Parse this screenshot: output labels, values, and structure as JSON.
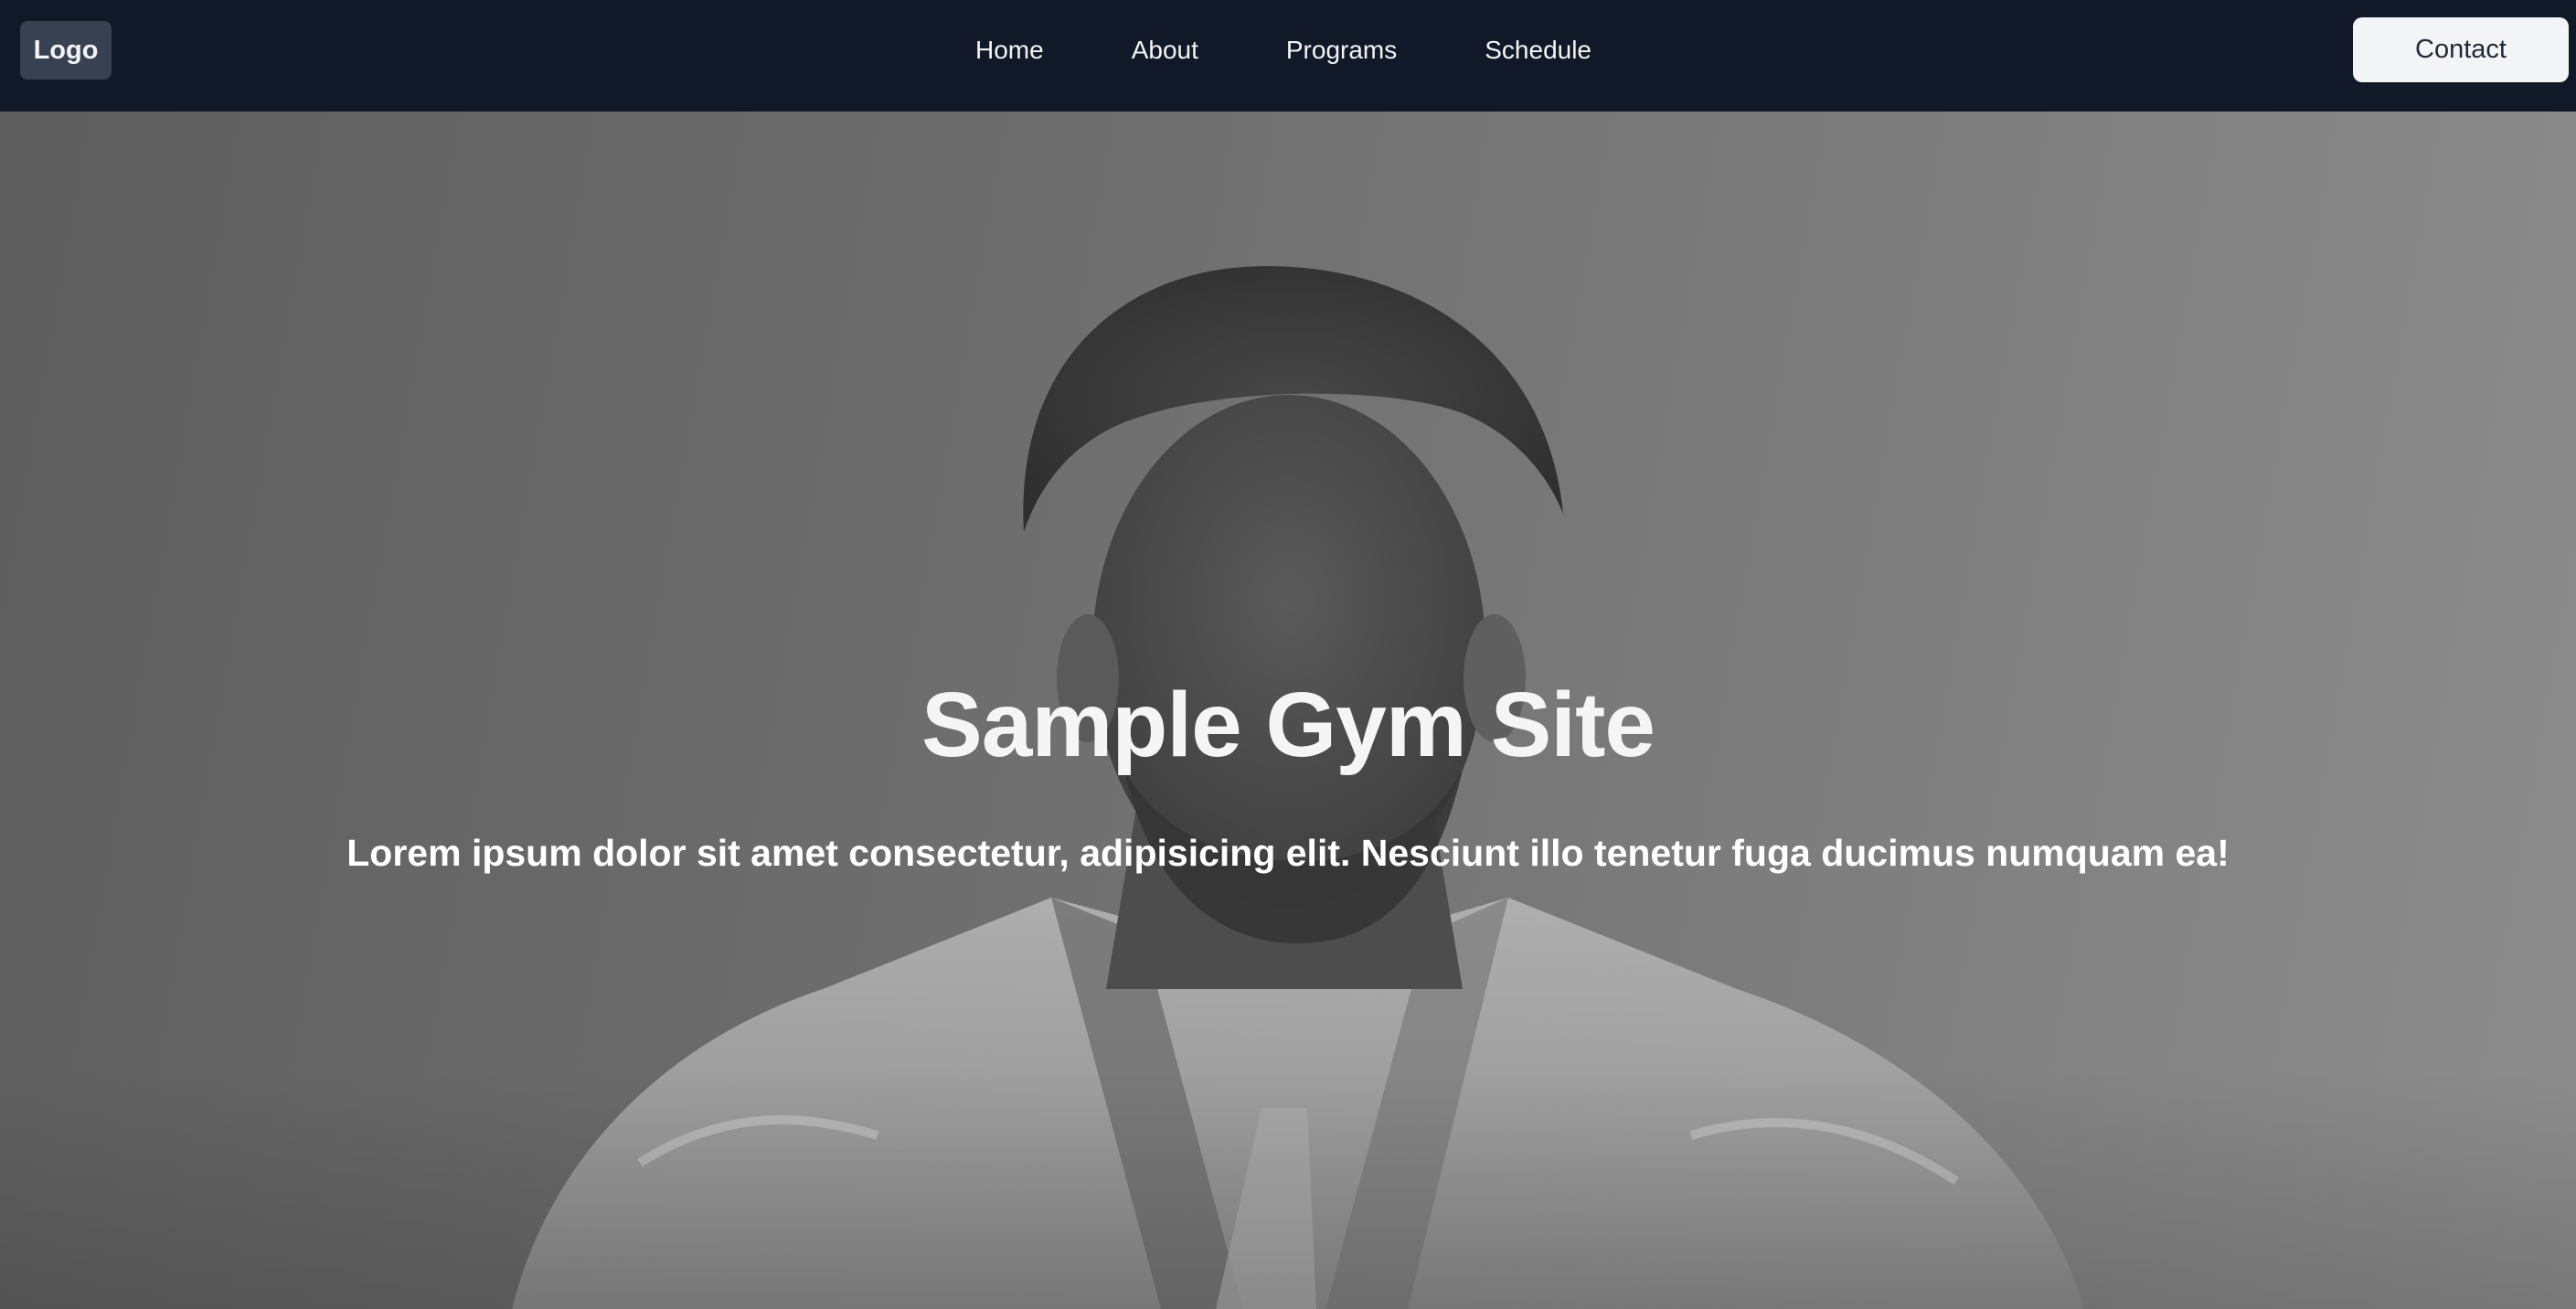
{
  "header": {
    "logo_label": "Logo",
    "nav": [
      {
        "label": "Home"
      },
      {
        "label": "About"
      },
      {
        "label": "Programs"
      },
      {
        "label": "Schedule"
      }
    ],
    "contact_label": "Contact"
  },
  "hero": {
    "title": "Sample Gym Site",
    "subtitle": "Lorem ipsum dolor sit amet consectetur, adipisicing elit. Nesciunt illo tenetur fuga ducimus numquam ea!",
    "image_subject": "martial-artist-portrait"
  },
  "colors": {
    "navbar_bg": "#111827",
    "logo_bg": "#374151",
    "contact_bg": "#f3f4f6",
    "text_light": "#f3f4f6"
  }
}
